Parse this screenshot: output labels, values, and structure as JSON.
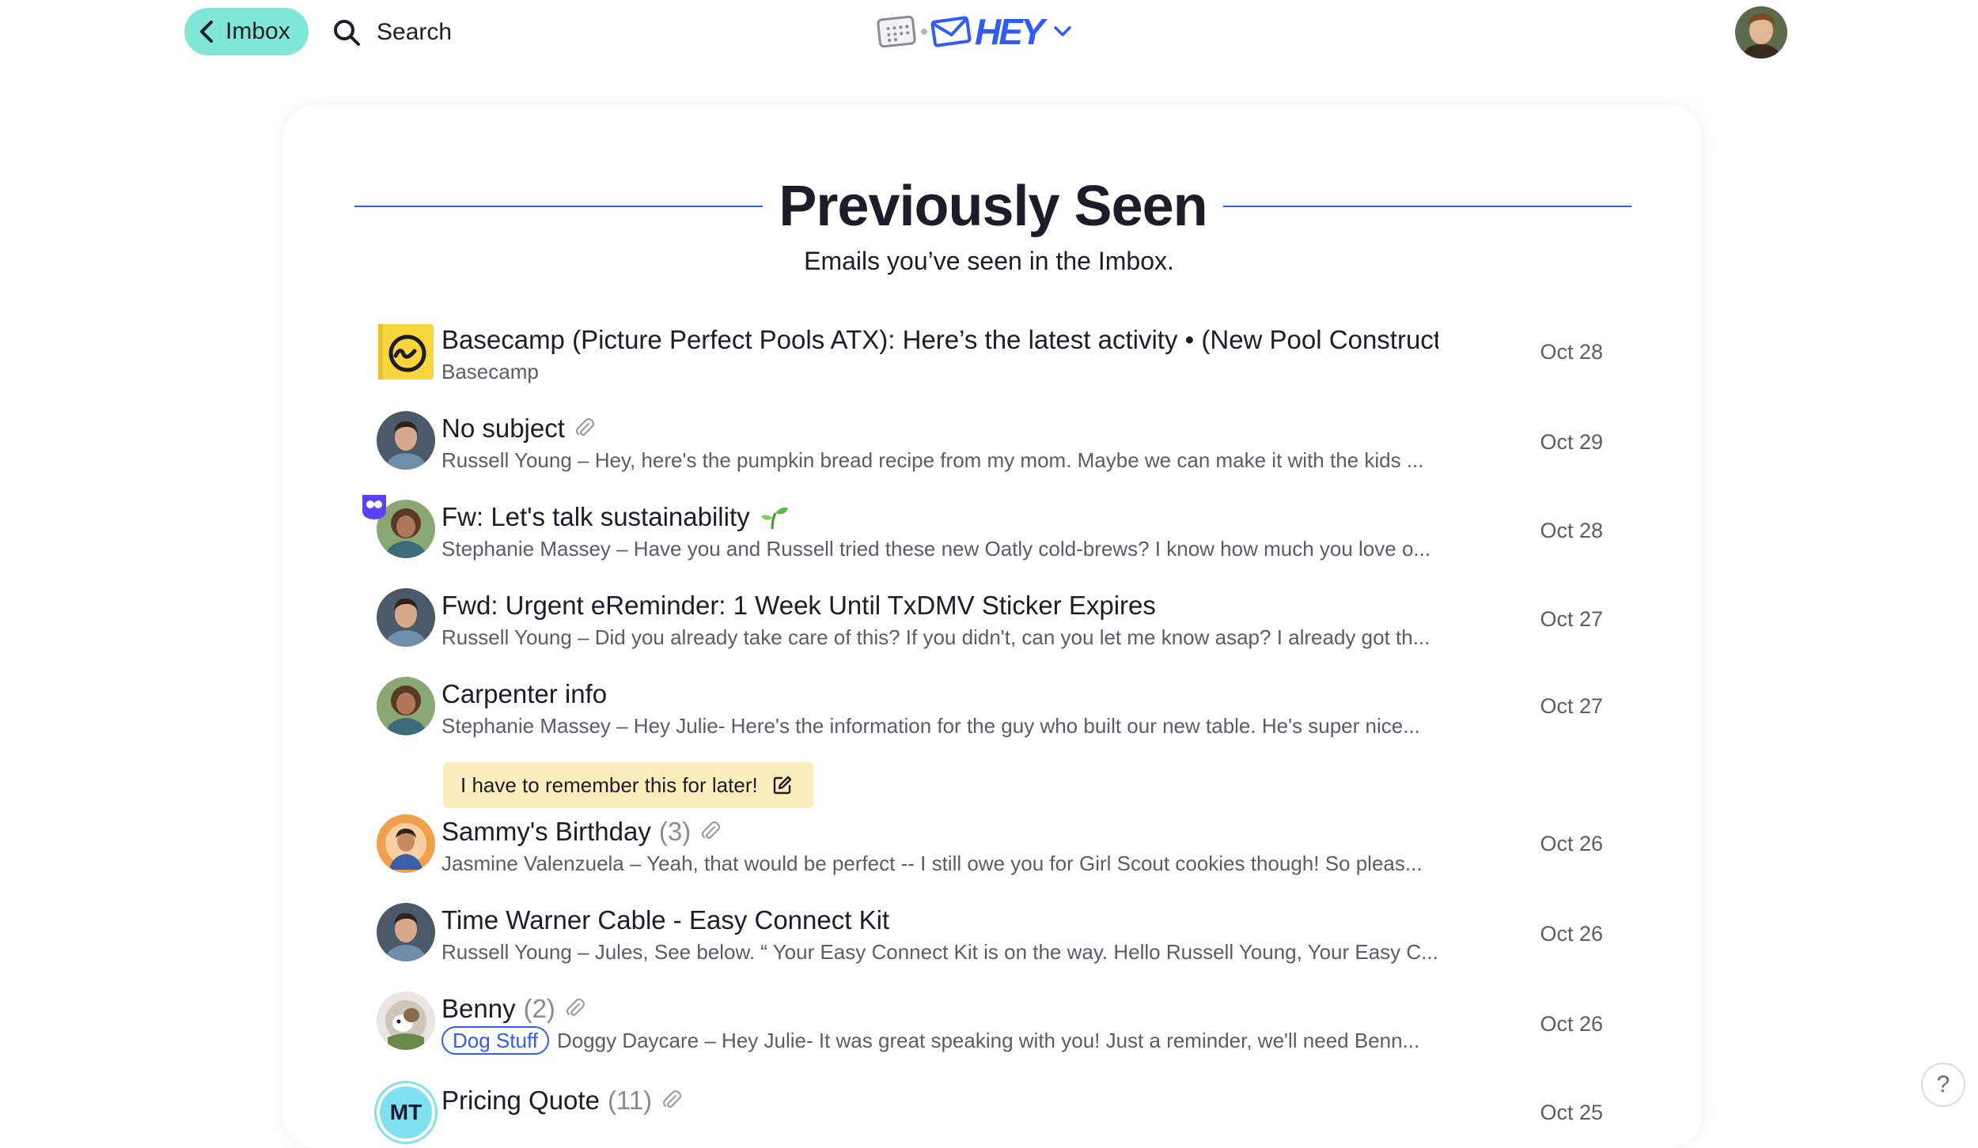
{
  "topbar": {
    "back_label": "Imbox",
    "search_label": "Search",
    "logo_text": "HEY"
  },
  "page": {
    "title": "Previously Seen",
    "subtitle": "Emails you’ve seen in the Imbox."
  },
  "emails": [
    {
      "subject": "Basecamp (Picture Perfect Pools ATX): Here’s the latest activity • (New Pool Constructi",
      "snippet": "Basecamp",
      "date": "Oct 28",
      "avatar": "basecamp-logo"
    },
    {
      "subject": "No subject",
      "snippet": "Russell Young – Hey, here's the pumpkin bread recipe from my mom. Maybe we can make it with the kids ...",
      "date": "Oct 29",
      "avatar": "russell-young",
      "attachment": true
    },
    {
      "subject": "Fw: Let's talk sustainability",
      "snippet": "Stephanie Massey – Have you and Russell tried these new Oatly cold-brews? I know how much you love o...",
      "date": "Oct 28",
      "avatar": "stephanie-massey",
      "emoji": "seedling-icon"
    },
    {
      "subject": "Fwd: Urgent eReminder: 1 Week Until TxDMV Sticker Expires",
      "snippet": "Russell Young – Did you already take care of this? If you didn't, can you let me know asap? I already got th...",
      "date": "Oct 27",
      "avatar": "russell-young"
    },
    {
      "subject": "Carpenter info",
      "snippet": "Stephanie Massey – Hey Julie- Here's the information for the guy who built our new table. He's super nice...",
      "date": "Oct 27",
      "avatar": "stephanie-massey",
      "note": "I have to remember this for later!"
    },
    {
      "subject": "Sammy's Birthday",
      "count": "(3)",
      "snippet": "Jasmine Valenzuela – Yeah, that would be perfect -- I still owe you for Girl Scout cookies though! So pleas...",
      "date": "Oct 26",
      "avatar": "jasmine-valenzuela",
      "attachment": true
    },
    {
      "subject": "Time Warner Cable - Easy Connect Kit",
      "snippet": "Russell Young – Jules, See below. “ Your Easy Connect Kit is on the way. Hello Russell Young, Your Easy C...",
      "date": "Oct 26",
      "avatar": "russell-young"
    },
    {
      "subject": "Benny",
      "count": "(2)",
      "tag": "Dog Stuff",
      "snippet": "Doggy Daycare – Hey Julie- It was great speaking with you! Just a reminder, we'll need Benn...",
      "date": "Oct 26",
      "avatar": "doggy-daycare",
      "attachment": true
    },
    {
      "subject": "Pricing Quote",
      "count": "(11)",
      "date": "Oct 25",
      "avatar": "MT",
      "attachment": true
    }
  ],
  "colors": {
    "accent": "#2f5bff",
    "back_button": "#7ee7d8",
    "note_bg": "#fbeebc",
    "basecamp_yellow": "#f8d63b"
  },
  "help": {
    "label": "?"
  }
}
